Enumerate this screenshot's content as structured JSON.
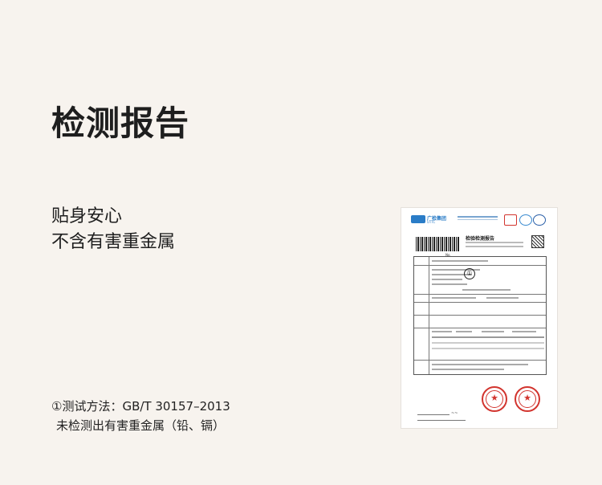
{
  "heading": "检测报告",
  "claims": [
    "贴身安心",
    "不含有害重金属"
  ],
  "note": {
    "line1": "①测试方法：GB/T 30157–2013",
    "line2": "未检测出有害重金属（铅、镉）"
  },
  "report": {
    "brand": "广检集团",
    "brand_sub": "UTTC",
    "doc_title": "检验检测报告",
    "marker": "①",
    "accent_color": "#2a7cc7",
    "stamp_color": "#d2342e",
    "stamp_symbol": "★"
  }
}
